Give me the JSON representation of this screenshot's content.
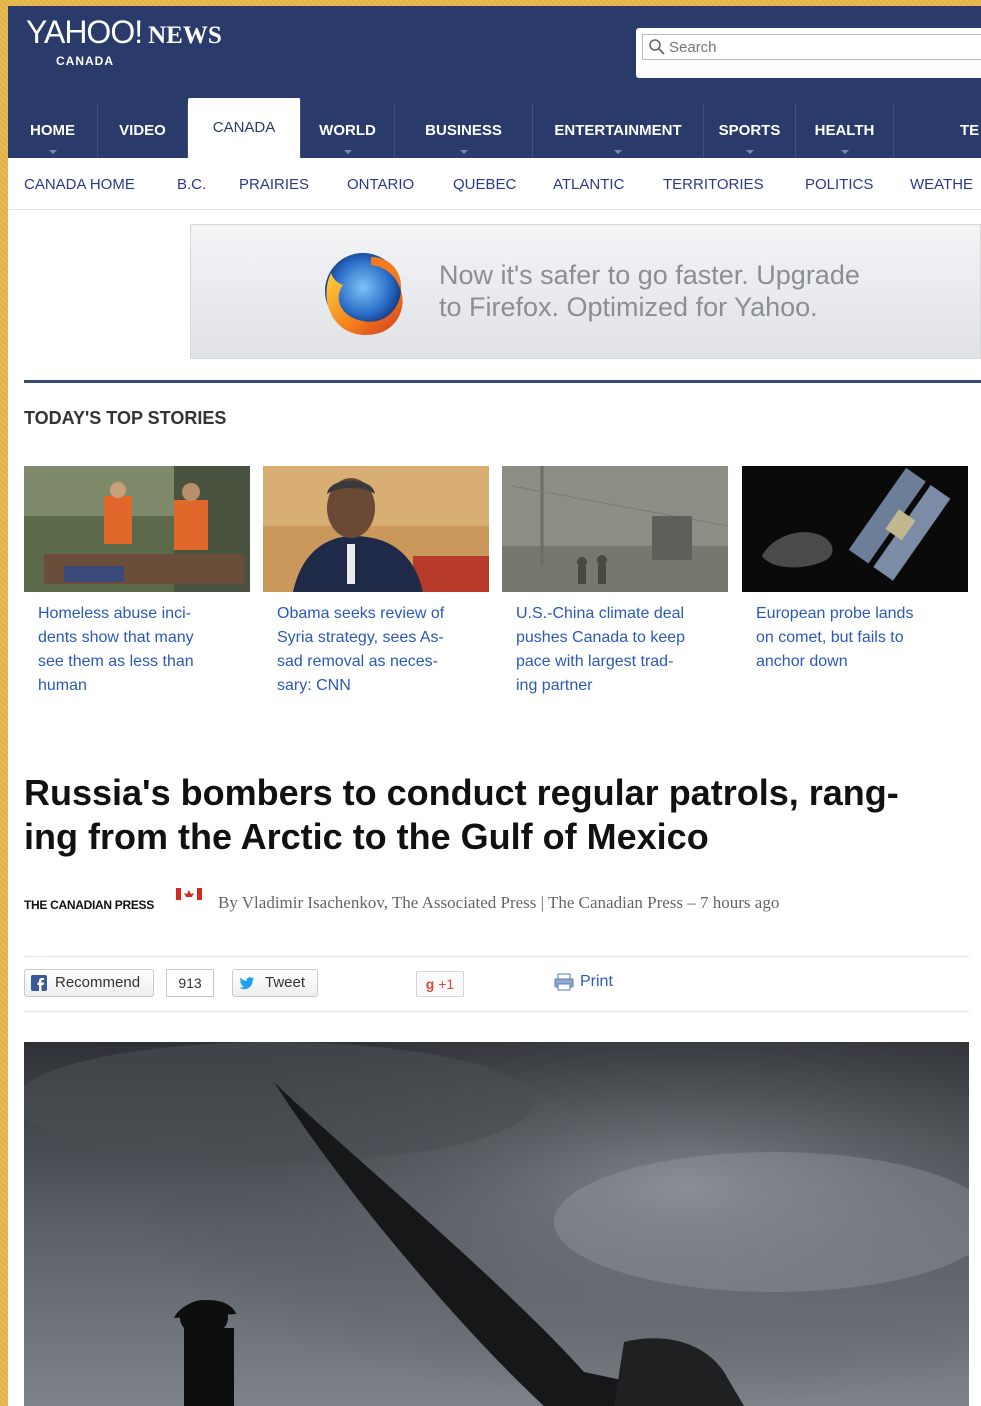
{
  "header": {
    "logo_yahoo": "YAHOO!",
    "logo_news": "NEWS",
    "logo_sub": "CANADA",
    "search_placeholder": "Search"
  },
  "nav": {
    "tabs": [
      {
        "label": "HOME",
        "active": false,
        "caret": true
      },
      {
        "label": "VIDEO",
        "active": false,
        "caret": false
      },
      {
        "label": "CANADA",
        "active": true,
        "caret": false
      },
      {
        "label": "WORLD",
        "active": false,
        "caret": true
      },
      {
        "label": "BUSINESS",
        "active": false,
        "caret": true
      },
      {
        "label": "ENTERTAINMENT",
        "active": false,
        "caret": true
      },
      {
        "label": "SPORTS",
        "active": false,
        "caret": true
      },
      {
        "label": "HEALTH",
        "active": false,
        "caret": true
      },
      {
        "label": "TE",
        "active": false,
        "caret": false
      }
    ],
    "subnav": [
      "CANADA HOME",
      "B.C.",
      "PRAIRIES",
      "ONTARIO",
      "QUEBEC",
      "ATLANTIC",
      "TERRITORIES",
      "POLITICS",
      "WEATHE"
    ]
  },
  "ad": {
    "line1": "Now it's safer to go faster. Upgrade",
    "line2": "to Firefox. Optimized for Yahoo."
  },
  "top_stories": {
    "heading": "TODAY'S TOP STORIES",
    "items": [
      {
        "lines": [
          "Homeless abuse inci-",
          "dents show that many",
          "see them as less than",
          "human"
        ]
      },
      {
        "lines": [
          "Obama seeks review of",
          "Syria strategy, sees As-",
          "sad removal as neces-",
          "sary: CNN"
        ]
      },
      {
        "lines": [
          "U.S.-China climate deal",
          "pushes Canada to keep",
          "pace with largest trad-",
          "ing partner"
        ]
      },
      {
        "lines": [
          "European probe lands",
          "on comet, but fails to",
          "anchor down"
        ]
      }
    ]
  },
  "article": {
    "headline_line1": "Russia's bombers to conduct regular patrols, rang-",
    "headline_line2": "ing from the Arctic to the Gulf of Mexico",
    "source_logo": "THE CANADIAN PRESS",
    "byline": "By Vladimir Isachenkov, The Associated Press | The Canadian Press – 7 hours ago"
  },
  "share": {
    "recommend": "Recommend",
    "recommend_count": "913",
    "tweet": "Tweet",
    "gplus": "+1",
    "print": "Print"
  },
  "colors": {
    "masthead": "#2a3a6b",
    "link": "#2a59b8",
    "page_border": "#e8b84a"
  }
}
